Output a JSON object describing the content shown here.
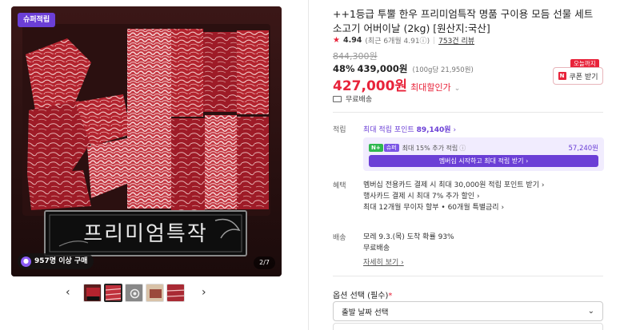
{
  "gallery": {
    "badge": "슈퍼적립",
    "buyers": "957명 이상 구매",
    "counter": "2/7",
    "banner_text": "프리미엄특작",
    "thumbnails": [
      "thumb-1",
      "thumb-2",
      "thumb-3",
      "thumb-4",
      "thumb-5"
    ],
    "active_thumb": 1
  },
  "product": {
    "title": "++1등급 투뿔 한우 프리미엄특작 명품 구이용 모듬 선물 세트 소고기 어버이날 (2kg) [원산지:국산]",
    "rating": "4.94",
    "rating_sub": "(최근 6개월 4.91",
    "rating_sub_end": ")",
    "reviews": "753건 리뷰",
    "original_price": "844,300원",
    "discount_rate": "48%",
    "discount_price": "439,000원",
    "unit_price": "(100g당 21,950원)",
    "final_price": "427,000원",
    "max_discount_label": "최대할인가",
    "coupon_tag": "오늘까지",
    "coupon_label": "쿠폰 받기",
    "shipping": "무료배송"
  },
  "points": {
    "label": "적립",
    "max_points": "최대 적립 포인트",
    "max_points_value": "89,140원",
    "member_badge_n": "N+",
    "member_badge_p": "슈퍼",
    "member_text": "최대 15% 추가 적립",
    "member_amount": "57,240원",
    "member_button": "멤버십 시작하고 최대 적립 받기"
  },
  "benefits": {
    "label": "혜택",
    "items": [
      "멤버십 전용카드 결제 시 최대 30,000원 적립 포인트 받기",
      "행사카드 결제 시 최대 7% 추가 할인",
      "최대 12개월 무이자 할부 • 60개월 특별금리"
    ]
  },
  "delivery": {
    "label": "배송",
    "eta": "모레 9.3.(목) 도착 확률 93%",
    "fee": "무료배송",
    "details": "자세히 보기"
  },
  "options": {
    "title": "옵션 선택 (필수)",
    "required_mark": "*",
    "select_placeholder": "출발 날짜 선택"
  },
  "colors": {
    "accent_red": "#e8233a",
    "accent_purple": "#6b3fd6",
    "naver_green": "#2fb84f"
  }
}
